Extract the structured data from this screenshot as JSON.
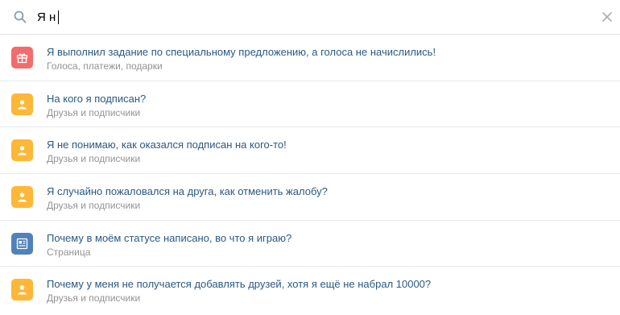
{
  "search": {
    "value": "Я н",
    "placeholder": ""
  },
  "colors": {
    "accent_link": "#2a5885",
    "gift_icon_bg": "#f36b6b",
    "user_icon_bg": "#ffb737",
    "page_icon_bg": "#5181b8"
  },
  "results": [
    {
      "icon": "gift-icon",
      "title": "Я выполнил задание по специальному предложению, а голоса не начислились!",
      "category": "Голоса, платежи, подарки"
    },
    {
      "icon": "user-icon",
      "title": "На кого я подписан?",
      "category": "Друзья и подписчики"
    },
    {
      "icon": "user-icon",
      "title": "Я не понимаю, как оказался подписан на кого-то!",
      "category": "Друзья и подписчики"
    },
    {
      "icon": "user-icon",
      "title": "Я случайно пожаловался на друга, как отменить жалобу?",
      "category": "Друзья и подписчики"
    },
    {
      "icon": "page-icon",
      "title": "Почему в моём статусе написано, во что я играю?",
      "category": "Страница"
    },
    {
      "icon": "user-icon",
      "title": "Почему у меня не получается добавлять друзей, хотя я ещё не набрал 10000?",
      "category": "Друзья и подписчики"
    }
  ]
}
